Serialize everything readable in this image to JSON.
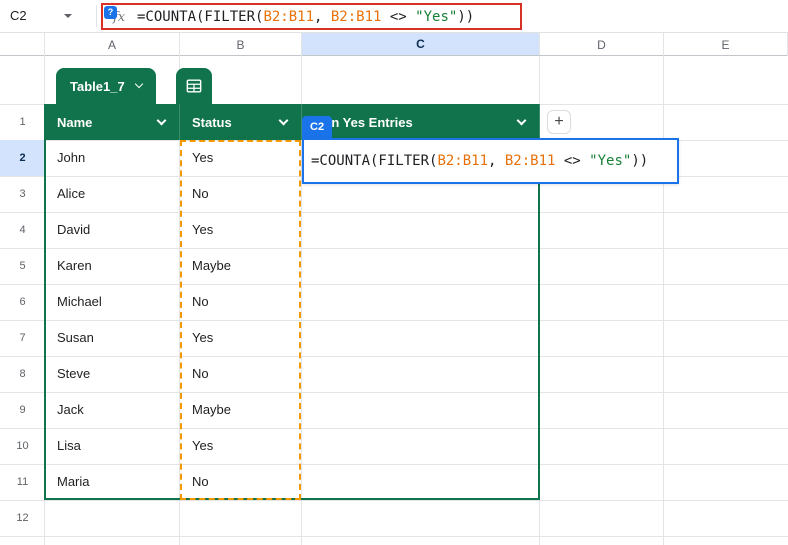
{
  "name_box": {
    "value": "C2"
  },
  "formula_bar": {
    "fx_label": "fx",
    "help_badge": "?"
  },
  "formula": {
    "tokens": [
      {
        "text": "=COUNTA(FILTER(",
        "color": "#202124"
      },
      {
        "text": "B2:B11",
        "color": "#e8710a"
      },
      {
        "text": ", ",
        "color": "#202124"
      },
      {
        "text": "B2:B11",
        "color": "#e8710a"
      },
      {
        "text": " <> ",
        "color": "#202124"
      },
      {
        "text": "\"Yes\"",
        "color": "#188038"
      },
      {
        "text": "))",
        "color": "#202124"
      }
    ]
  },
  "grid": {
    "column_headers": [
      "A",
      "B",
      "C",
      "D",
      "E"
    ],
    "row_numbers": [
      "1",
      "2",
      "3",
      "4",
      "5",
      "6",
      "7",
      "8",
      "9",
      "10",
      "11",
      "12"
    ],
    "selected_column": "C",
    "selected_row": "2"
  },
  "table": {
    "name": "Table1_7",
    "columns": [
      "Name",
      "Status",
      "Non Yes Entries"
    ],
    "add_column_button": "+",
    "rows": [
      {
        "name": "John",
        "status": "Yes"
      },
      {
        "name": "Alice",
        "status": "No"
      },
      {
        "name": "David",
        "status": "Yes"
      },
      {
        "name": "Karen",
        "status": "Maybe"
      },
      {
        "name": "Michael",
        "status": "No"
      },
      {
        "name": "Susan",
        "status": "Yes"
      },
      {
        "name": "Steve",
        "status": "No"
      },
      {
        "name": "Jack",
        "status": "Maybe"
      },
      {
        "name": "Lisa",
        "status": "Yes"
      },
      {
        "name": "Maria",
        "status": "No"
      }
    ]
  },
  "cell_editor": {
    "cell_label": "C2"
  },
  "highlighted_range": {
    "range": "B2:B11"
  },
  "colors": {
    "table_green": "#11734b",
    "selection_blue": "#1a73e8",
    "header_highlight": "#d3e3fd",
    "range_orange": "#f29900",
    "formula_outline_red": "#d93025",
    "range_text_orange": "#e8710a",
    "string_green": "#188038"
  }
}
